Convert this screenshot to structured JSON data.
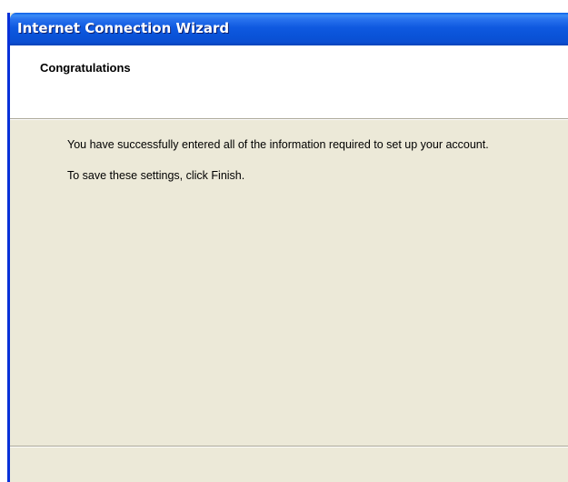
{
  "window": {
    "title": "Internet Connection Wizard",
    "title_bar_color": "#0a53d8",
    "background_color": "#ece9d8"
  },
  "header": {
    "title": "Congratulations"
  },
  "content": {
    "line1": "You have successfully entered all of the information required to set up your account.",
    "line2": "To save these settings, click Finish."
  }
}
